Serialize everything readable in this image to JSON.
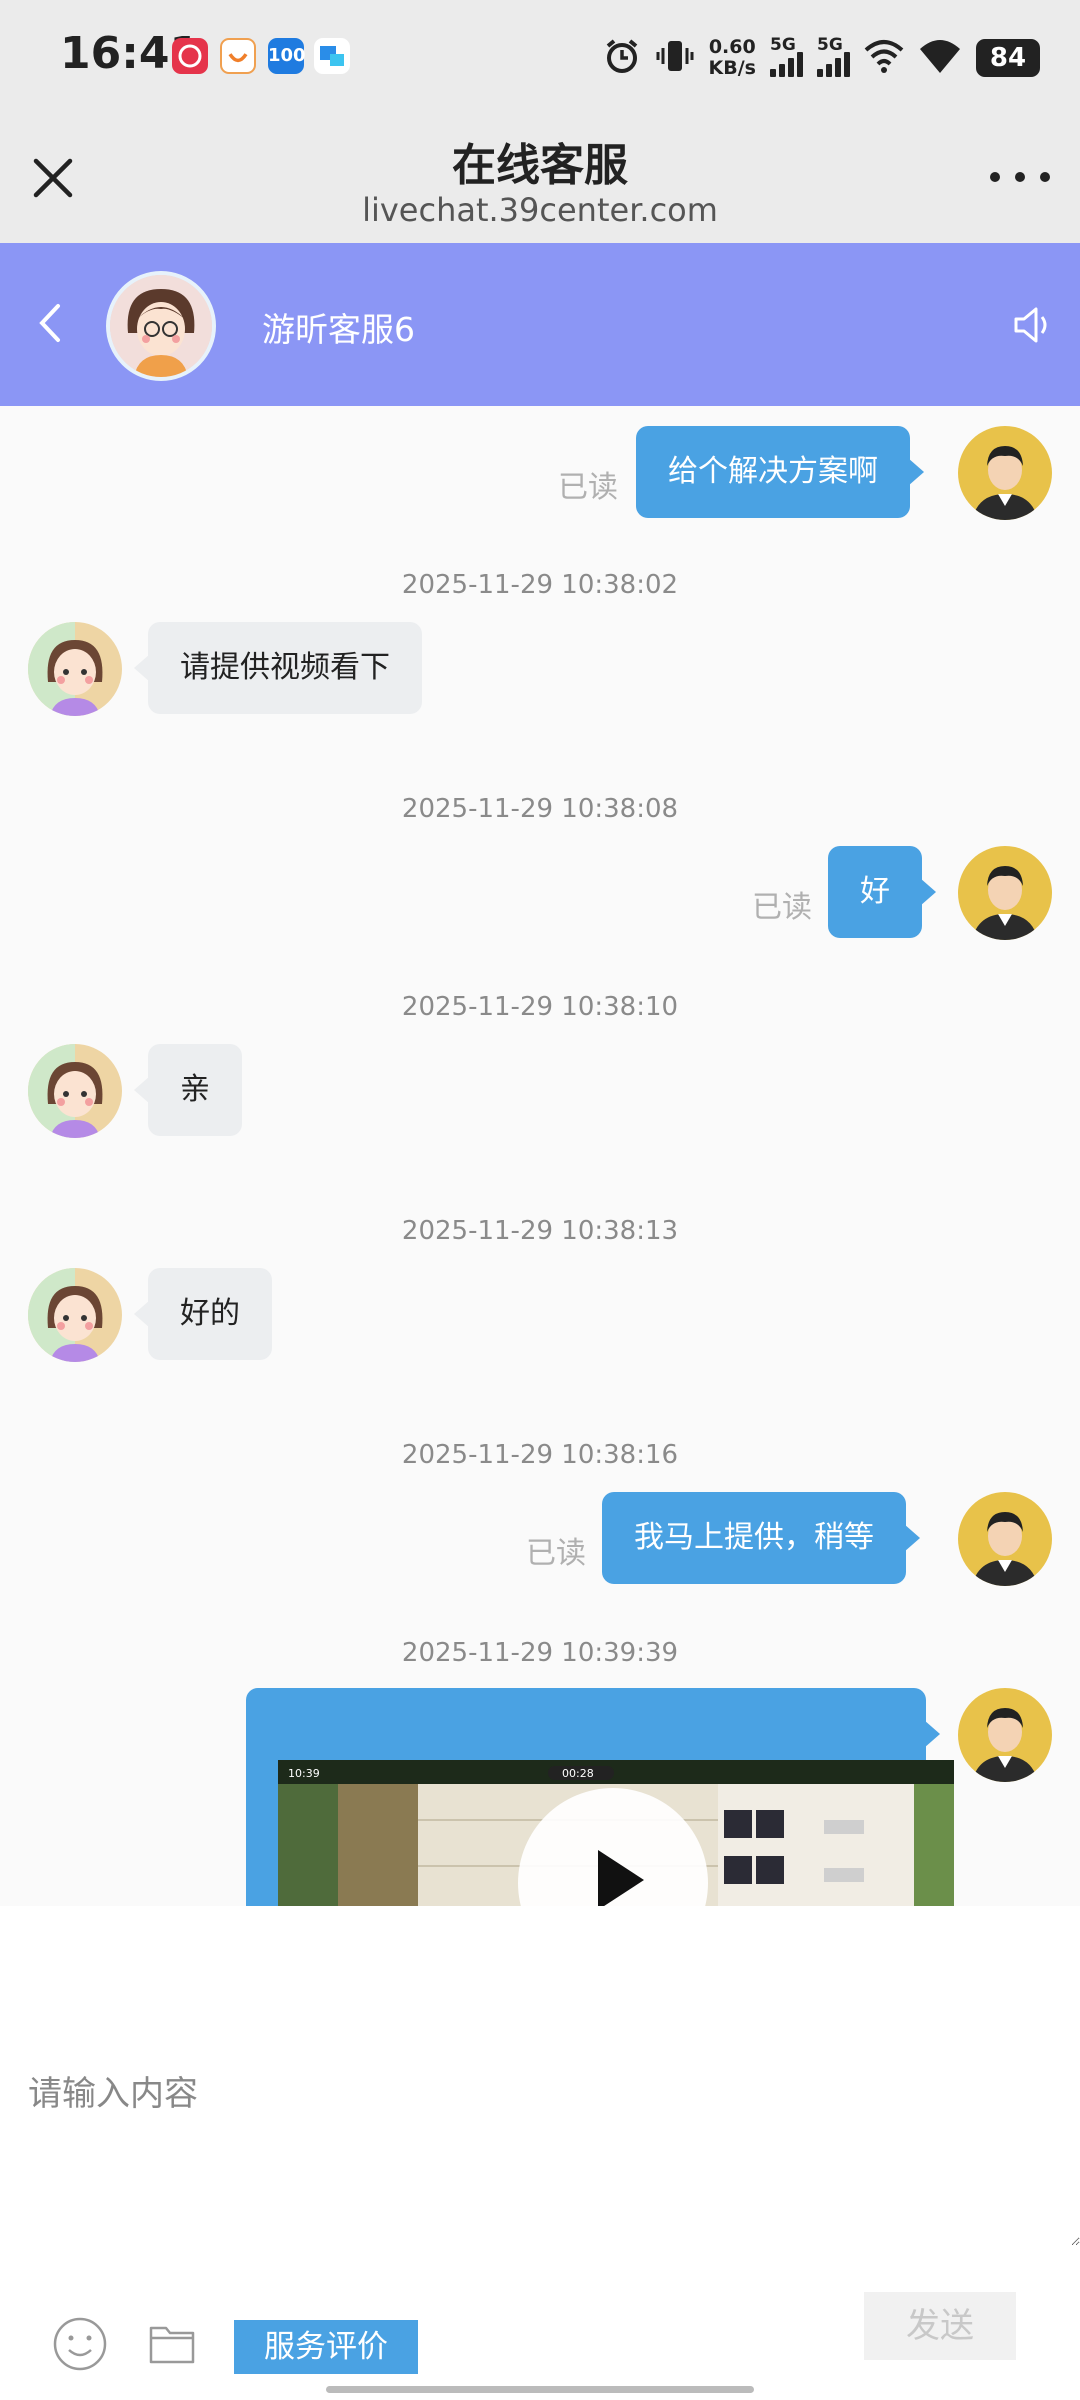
{
  "status_bar": {
    "time": "16:41",
    "app_icons": [
      "app-icon-red",
      "app-icon-orange",
      "100",
      "app-icon-blue"
    ],
    "net_speed_value": "0.60",
    "net_speed_unit": "KB/s",
    "signal_1_label": "5G",
    "signal_2_label": "5G",
    "battery": "84"
  },
  "browser": {
    "title": "在线客服",
    "url": "livechat.39center.com"
  },
  "chat_header": {
    "agent_name": "游昕客服6"
  },
  "messages": [
    {
      "type": "user",
      "text": "给个解决方案啊",
      "read": "已读"
    },
    {
      "type": "timestamp",
      "text": "2025-11-29 10:38:02"
    },
    {
      "type": "agent",
      "text": "请提供视频看下"
    },
    {
      "type": "timestamp",
      "text": "2025-11-29 10:38:08"
    },
    {
      "type": "user",
      "text": "好",
      "read": "已读"
    },
    {
      "type": "timestamp",
      "text": "2025-11-29 10:38:10"
    },
    {
      "type": "agent",
      "text": "亲"
    },
    {
      "type": "timestamp",
      "text": "2025-11-29 10:38:13"
    },
    {
      "type": "agent",
      "text": "好的"
    },
    {
      "type": "timestamp",
      "text": "2025-11-29 10:38:16"
    },
    {
      "type": "user",
      "text": "我马上提供，稍等",
      "read": "已读"
    },
    {
      "type": "timestamp",
      "text": "2025-11-29 10:39:39"
    },
    {
      "type": "user_video",
      "duration": "00:28"
    }
  ],
  "composer": {
    "placeholder": "请输入内容",
    "rate_label": "服务评价",
    "send_label": "发送"
  },
  "colors": {
    "header_bg": "#8b96f5",
    "user_bubble": "#4aa2e3",
    "agent_bubble": "#eceef0",
    "topbar_bg": "#ebebeb"
  }
}
